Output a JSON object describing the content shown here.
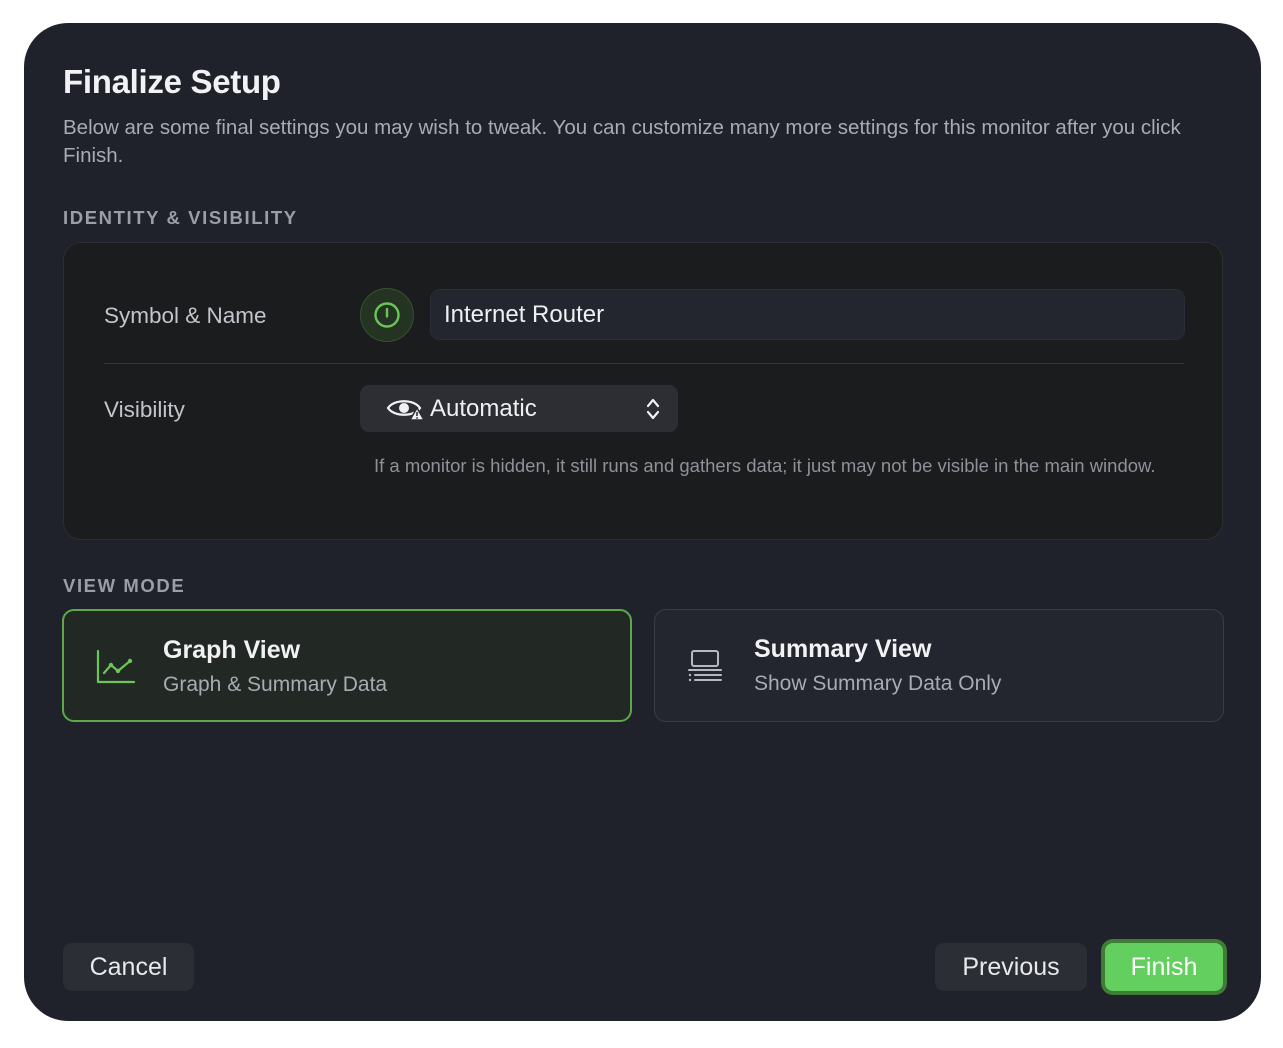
{
  "dialog": {
    "title": "Finalize Setup",
    "subtitle": "Below are some final settings you may wish to tweak. You can customize many more settings for this monitor after you click Finish."
  },
  "identity": {
    "section_label": "IDENTITY & VISIBILITY",
    "symbol_name_label": "Symbol & Name",
    "symbol_icon": "power-icon",
    "name_value": "Internet Router",
    "visibility_label": "Visibility",
    "visibility_icon": "eye-warning-icon",
    "visibility_value": "Automatic",
    "visibility_help": "If a monitor is hidden, it still runs and gathers data; it just may not be visible in the main window."
  },
  "view_mode": {
    "section_label": "VIEW MODE",
    "options": [
      {
        "title": "Graph View",
        "subtitle": "Graph & Summary Data",
        "icon": "line-chart-icon",
        "selected": true
      },
      {
        "title": "Summary View",
        "subtitle": "Show Summary Data Only",
        "icon": "summary-list-icon",
        "selected": false
      }
    ]
  },
  "footer": {
    "cancel_label": "Cancel",
    "previous_label": "Previous",
    "finish_label": "Finish"
  },
  "colors": {
    "accent": "#63cf5f",
    "selected_border": "#5ea84a",
    "dialog_background": "#1f212b"
  }
}
